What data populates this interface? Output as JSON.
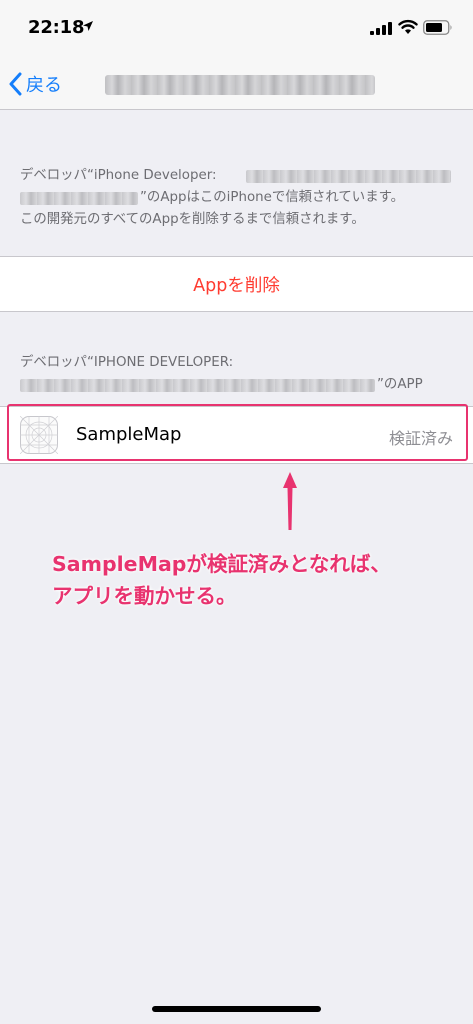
{
  "status_bar": {
    "time": "22:18",
    "icons": [
      "location-arrow-icon",
      "cellular-signal-icon",
      "wifi-icon",
      "battery-icon"
    ]
  },
  "nav": {
    "back_label": "戻る",
    "back_icon": "chevron-left-icon"
  },
  "trust_description": {
    "line1_prefix": "デベロッパ“iPhone Developer:",
    "line2_suffix": "”のAppはこのiPhoneで信頼されています。",
    "line3": "この開発元のすべてのAppを削除するまで信頼されます。"
  },
  "delete_app_label": "Appを削除",
  "section_header": {
    "line1": "デベロッパ“IPHONE DEVELOPER:",
    "line2_suffix": "”のAPP"
  },
  "app_row": {
    "name": "SampleMap",
    "status": "検証済み",
    "icon": "app-placeholder-icon"
  },
  "annotation": {
    "line1": "SampleMapが検証済みとなれば、",
    "line2": "アプリを動かせる。"
  },
  "colors": {
    "accent_blue": "#147efb",
    "destructive_red": "#ff3b30",
    "annotation_pink": "#e8336f",
    "background": "#efeff4"
  }
}
